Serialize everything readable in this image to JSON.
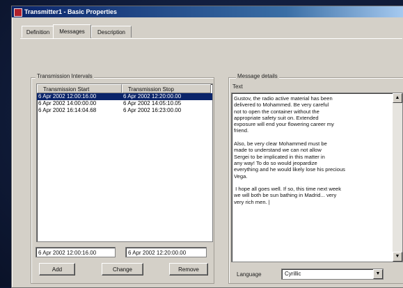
{
  "window": {
    "title": "Transmitter1 - Basic Properties"
  },
  "tabs": [
    "Definition",
    "Messages",
    "Description"
  ],
  "active_tab": "Messages",
  "transmission": {
    "group_label": "Transmission Intervals",
    "columns": [
      "Transmission Start",
      "Transmission Stop"
    ],
    "rows": [
      {
        "start": "6 Apr 2002 12:00:16.00",
        "stop": "6 Apr 2002 12:20:00.00"
      },
      {
        "start": "6 Apr 2002 14:00:00.00",
        "stop": "6 Apr 2002 14:05:10.05"
      },
      {
        "start": "6 Apr 2002 16:14:04.68",
        "stop": "6 Apr 2002 16:23:00.00"
      }
    ],
    "selected_row": 0,
    "start_value": "6 Apr 2002 12:00:16.00",
    "stop_value": "6 Apr 2002 12:20:00.00",
    "buttons": {
      "add": "Add",
      "change": "Change",
      "remove": "Remove"
    }
  },
  "message": {
    "group_label": "Message details",
    "text_label": "Text",
    "text": "Gustov, the radio active material has been\ndelivered to Mohammed. Be very careful\nnot to open the container without the\nappropriate safety suit on. Extended\nexposure will end your flowering career my\nfriend.\n\nAlso, be very clear Mohammed must be\nmade to understand we can not allow\nSergei to be implicated in this matter in\nany way! To do so would jeopardize\neverything and he would likely lose his precious\nVega.\n\n I hope all goes well. If so, this time next week\nwe will both be sun bathing in Madrid... very\nvery rich men. |",
    "language_label": "Language",
    "language_value": "Cyrillic"
  },
  "icons": {
    "scroll_up": "up-arrow-icon",
    "scroll_down": "down-arrow-icon",
    "dropdown": "chevron-down-icon"
  }
}
